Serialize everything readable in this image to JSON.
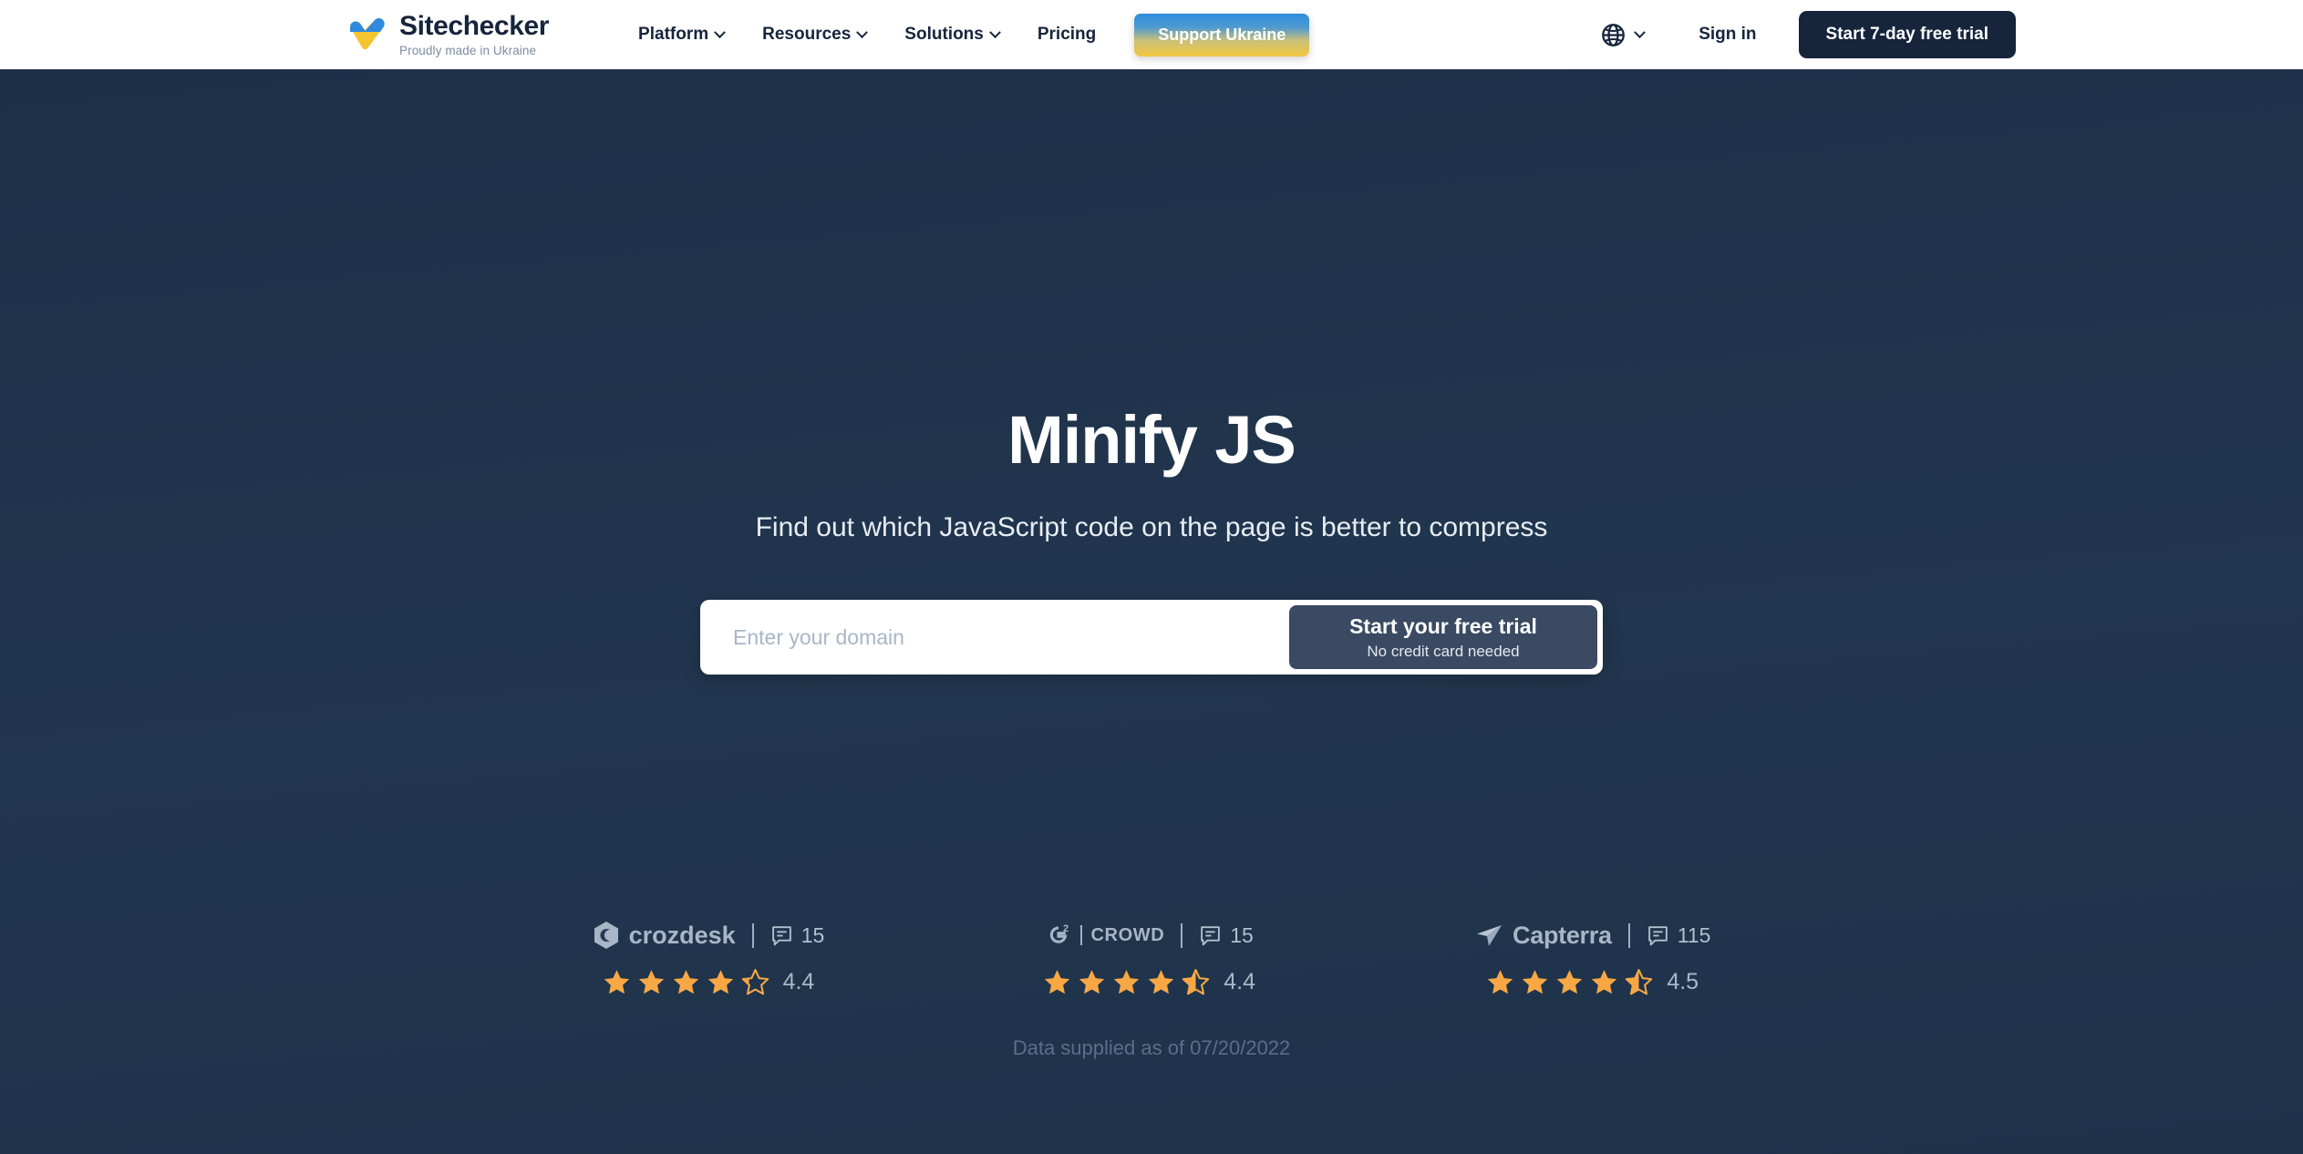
{
  "header": {
    "logo": {
      "name": "Sitechecker",
      "tagline": "Proudly made in Ukraine",
      "mark_blue": "#2f8ae0",
      "mark_yellow": "#f5c431"
    },
    "nav": [
      {
        "label": "Platform",
        "has_chevron": true
      },
      {
        "label": "Resources",
        "has_chevron": true
      },
      {
        "label": "Solutions",
        "has_chevron": true
      },
      {
        "label": "Pricing",
        "has_chevron": false
      }
    ],
    "support_button": "Support Ukraine",
    "language_icon": "globe-icon",
    "sign_in": "Sign in",
    "trial_button": "Start 7-day free trial"
  },
  "hero": {
    "title": "Minify JS",
    "subtitle": "Find out which JavaScript code on the page is better to compress",
    "input_placeholder": "Enter your domain",
    "input_value": "",
    "cta_main": "Start your free trial",
    "cta_sub": "No credit card needed"
  },
  "reviews": {
    "items": [
      {
        "brand": "crozdesk",
        "logo_icon": "crozdesk-hexagon-icon",
        "review_count": "15",
        "rating": "4.4",
        "stars_filled": 4,
        "star_partial": 0.25
      },
      {
        "brand": "G2",
        "brand_suffix": "CROWD",
        "logo_icon": "g2-crowd-icon",
        "review_count": "15",
        "rating": "4.4",
        "stars_filled": 4,
        "star_partial": 0.5
      },
      {
        "brand": "Capterra",
        "logo_icon": "capterra-plane-icon",
        "review_count": "115",
        "rating": "4.5",
        "stars_filled": 4,
        "star_partial": 0.5
      }
    ],
    "footnote": "Data supplied as of 07/20/2022"
  },
  "colors": {
    "background": "#1e3049",
    "dark_navy": "#16243c",
    "star_orange": "#f7a845",
    "muted_text": "#a8b6c6"
  }
}
